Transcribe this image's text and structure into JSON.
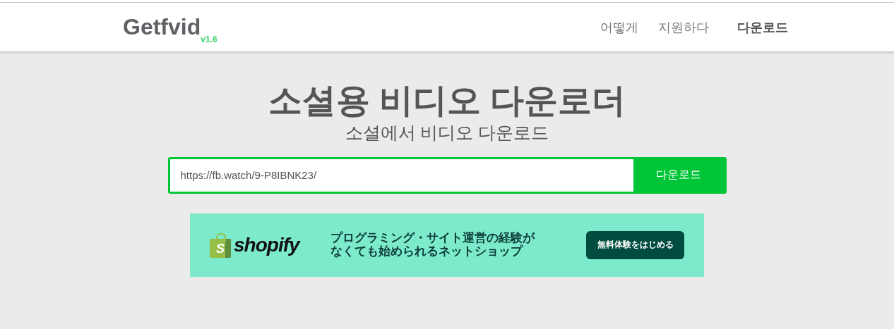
{
  "header": {
    "logo": "Getfvid",
    "version": "v1.6",
    "nav": [
      {
        "label": "어떻게",
        "selected": false
      },
      {
        "label": "지원하다",
        "selected": false
      },
      {
        "label": "다운로드",
        "selected": true
      }
    ]
  },
  "hero": {
    "title": "소셜용 비디오 다운로더",
    "subtitle": "소셜에서 비디오 다운로드"
  },
  "form": {
    "value": "https://fb.watch/9-P8IBNK23/",
    "button": "다운로드"
  },
  "ad": {
    "bag_letter": "S",
    "brand": "shopify",
    "text": [
      "プログラミング・サイト運営の経験が",
      "なくても始められるネットショップ"
    ],
    "button": "無料体験をはじめる"
  }
}
